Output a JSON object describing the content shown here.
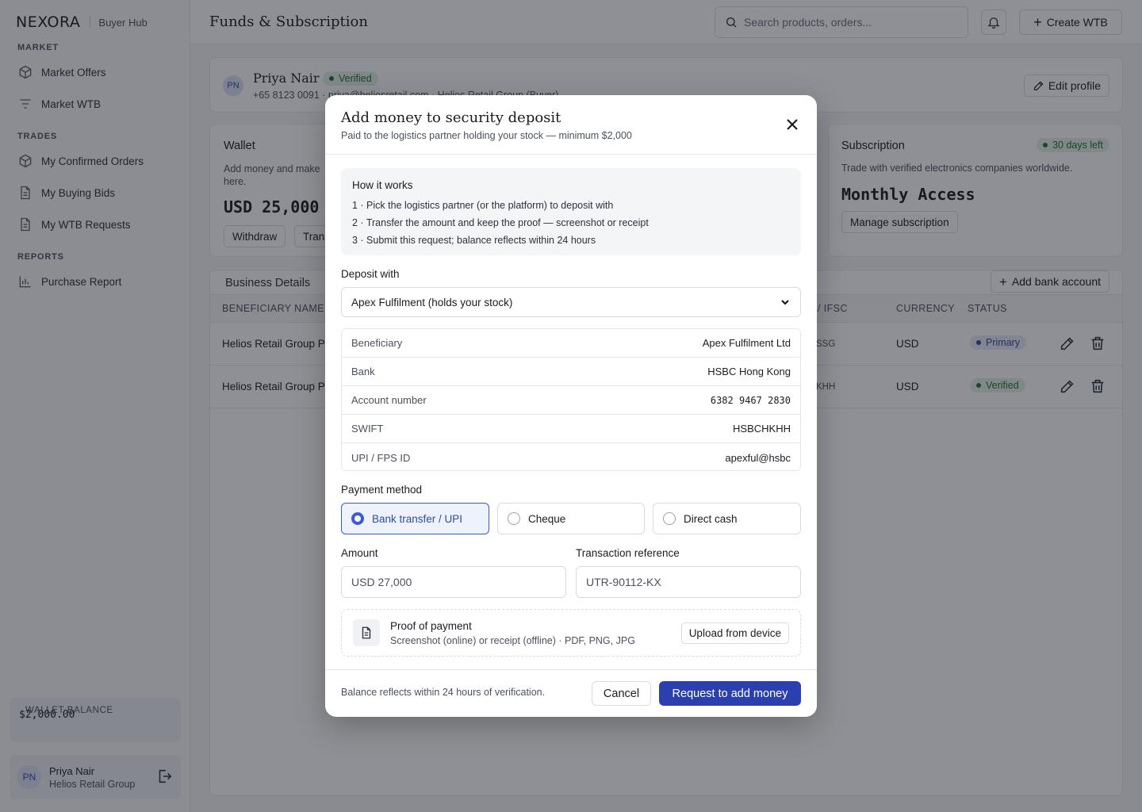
{
  "app": {
    "brand": "NEXORA",
    "brand_sub": "Buyer Hub",
    "page_title": "Funds & Subscription"
  },
  "sidebar": {
    "sections": [
      {
        "title": "MARKET",
        "items": [
          {
            "label": "Market Offers",
            "icon": "cube-icon"
          },
          {
            "label": "Market WTB",
            "icon": "filter-icon"
          }
        ]
      },
      {
        "title": "TRADES",
        "items": [
          {
            "label": "My Confirmed Orders",
            "icon": "cube-icon"
          },
          {
            "label": "My Buying Bids",
            "icon": "document-icon"
          },
          {
            "label": "My WTB Requests",
            "icon": "document-icon"
          }
        ]
      },
      {
        "title": "REPORTS",
        "items": [
          {
            "label": "Purchase Report",
            "icon": "bar-chart-icon"
          }
        ]
      }
    ],
    "wallet_balance_label": "WALLET BALANCE",
    "wallet_balance_value": "$2,000.00",
    "user": {
      "initials": "PN",
      "name": "Priya Nair",
      "company": "Helios Retail Group"
    }
  },
  "topbar": {
    "search_placeholder": "Search products, orders...",
    "create_label": "Create WTB"
  },
  "profile": {
    "initials": "PN",
    "name": "Priya Nair",
    "badge": "Verified",
    "meta": "+65 8123 0091 · priya@heliosretail.com · Helios Retail Group (Buyer)",
    "edit_label": "Edit profile"
  },
  "wallet": {
    "title": "Wallet",
    "desc": "Add money and make here.",
    "amount": "USD 25,000",
    "withdraw_label": "Withdraw",
    "transfer_label": "Trans"
  },
  "subscription": {
    "title": "Subscription",
    "badge": "30 days left",
    "desc": "Trade with verified electronics companies worldwide.",
    "plan": "Monthly Access",
    "manage_label": "Manage subscription"
  },
  "business": {
    "title": "Business Details",
    "add_bank_label": "Add bank account",
    "headers": {
      "beneficiary": "BENEFICIARY NAME",
      "ifsc": "/ IFSC",
      "currency": "CURRENCY",
      "status": "STATUS"
    },
    "rows": [
      {
        "beneficiary": "Helios Retail Group P",
        "ifsc": "SSG",
        "currency": "USD",
        "status": "Primary"
      },
      {
        "beneficiary": "Helios Retail Group P",
        "ifsc": "KHH",
        "currency": "USD",
        "status": "Verified"
      }
    ]
  },
  "modal": {
    "title": "Add money to security deposit",
    "subtitle": "Paid to the logistics partner holding your stock — minimum $2,000",
    "how_title": "How it works",
    "steps": [
      "1 · Pick the logistics partner (or the platform) to deposit with",
      "2 · Transfer the amount and keep the proof — screenshot or receipt",
      "3 · Submit this request; balance reflects within 24 hours"
    ],
    "deposit_label": "Deposit with",
    "deposit_value": "Apex Fulfilment (holds your stock)",
    "details": [
      {
        "k": "Beneficiary",
        "v": "Apex Fulfilment Ltd"
      },
      {
        "k": "Bank",
        "v": "HSBC Hong Kong"
      },
      {
        "k": "Account number",
        "v": "6382 9467 2830"
      },
      {
        "k": "SWIFT",
        "v": "HSBCHKHH"
      },
      {
        "k": "UPI / FPS ID",
        "v": "apexful@hsbc"
      }
    ],
    "payment_label": "Payment method",
    "payment_options": [
      "Bank transfer / UPI",
      "Cheque",
      "Direct cash"
    ],
    "amount_label": "Amount",
    "amount_value": "USD 27,000",
    "ref_label": "Transaction reference",
    "ref_value": "UTR-90112-KX",
    "proof_title": "Proof of payment",
    "proof_desc": "Screenshot (online) or receipt (offline) · PDF, PNG, JPG",
    "upload_label": "Upload from device",
    "footer_note": "Balance reflects within 24 hours of verification.",
    "cancel_label": "Cancel",
    "submit_label": "Request to add money"
  },
  "colors": {
    "accent": "#2b3fae",
    "success": "#21703a",
    "primary_badge": "#2f4aa8"
  }
}
